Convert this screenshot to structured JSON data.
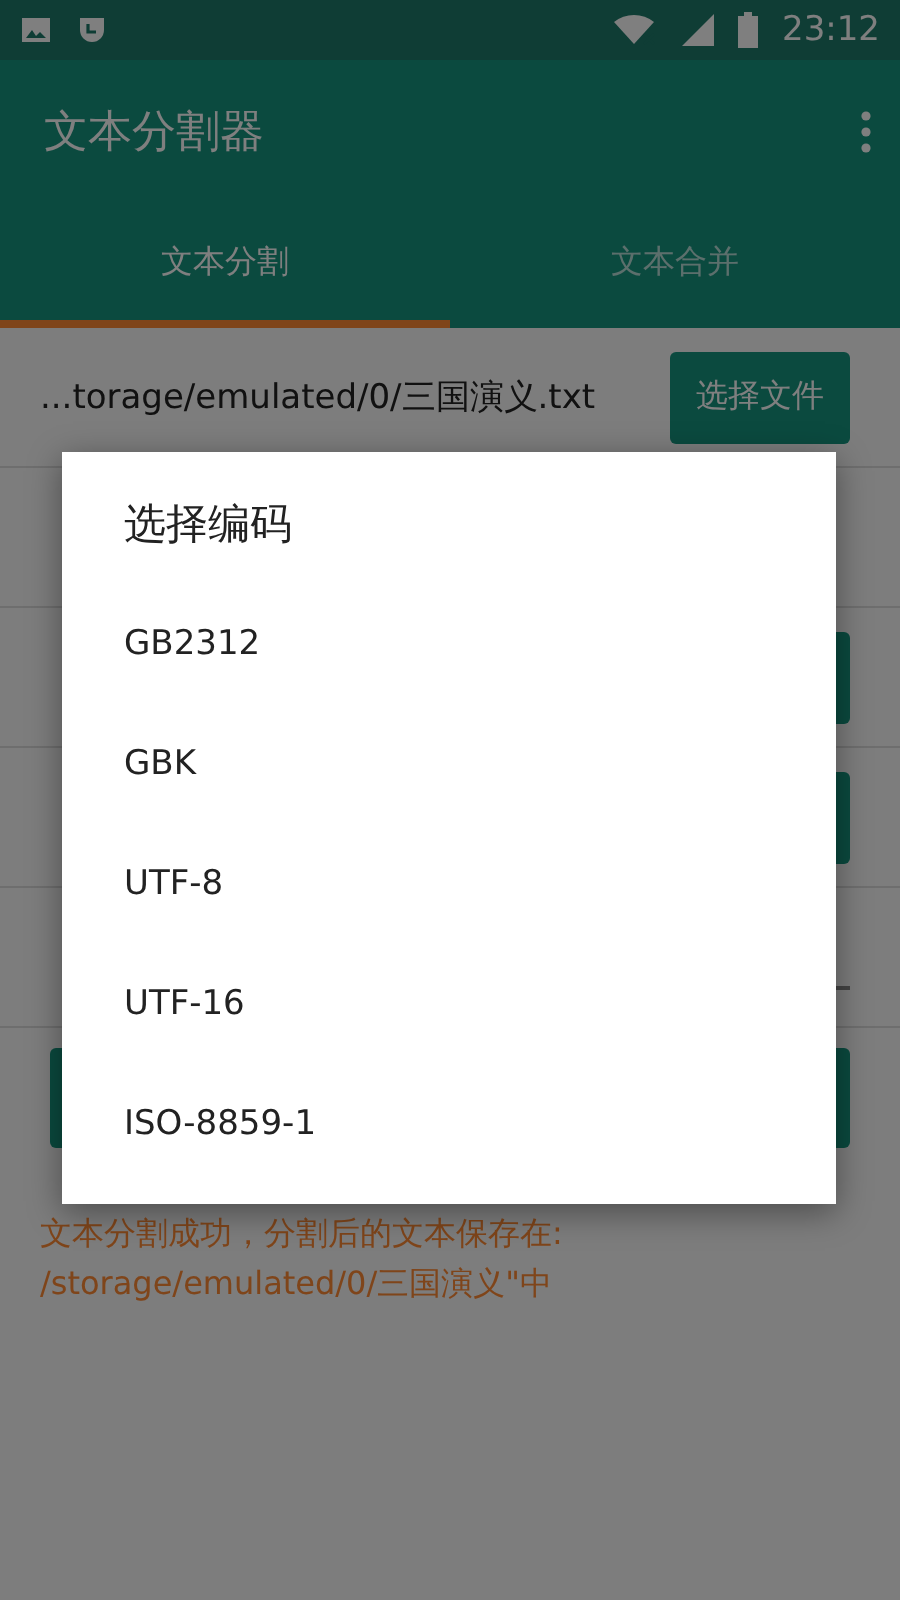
{
  "status_bar": {
    "time": "23:12"
  },
  "app_bar": {
    "title": "文本分割器"
  },
  "tabs": [
    {
      "label": "文本分割",
      "selected": true
    },
    {
      "label": "文本合并",
      "selected": false
    }
  ],
  "file_row": {
    "path": "...torage/emulated/0/三国演义.txt",
    "button": "选择文件"
  },
  "rows": [
    {
      "kind": "blank"
    },
    {
      "kind": "button"
    },
    {
      "kind": "button"
    },
    {
      "kind": "field"
    }
  ],
  "message": "文本分割成功，分割后的文本保存在: /storage/emulated/0/三国演义\"中",
  "dialog": {
    "title": "选择编码",
    "options": [
      "GB2312",
      "GBK",
      "UTF-8",
      "UTF-16",
      "ISO-8859-1"
    ]
  }
}
